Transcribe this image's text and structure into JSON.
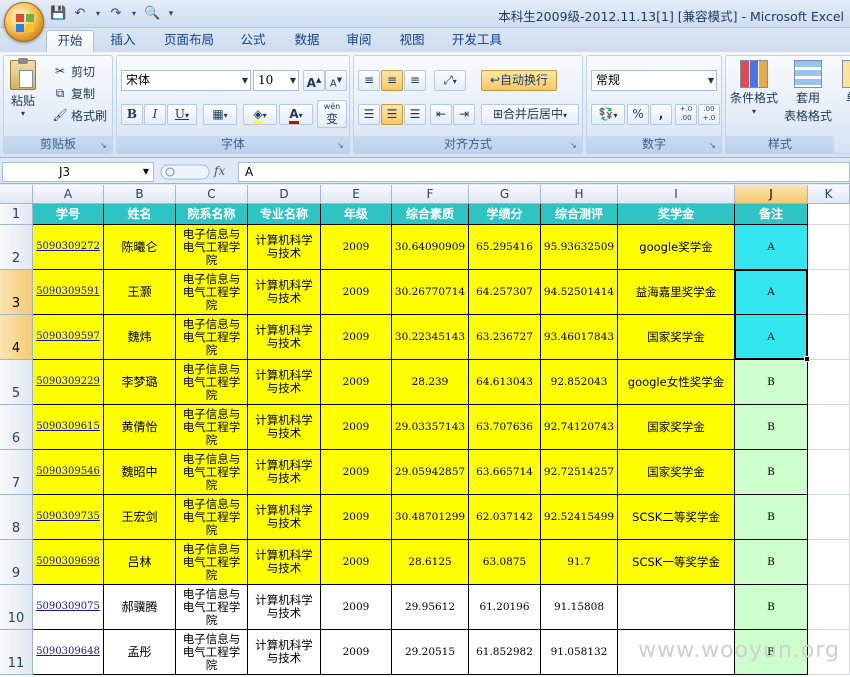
{
  "window": {
    "title": "本科生2009级-2012.11.13[1]  [兼容模式] - Microsoft Excel"
  },
  "tabs": [
    "开始",
    "插入",
    "页面布局",
    "公式",
    "数据",
    "审阅",
    "视图",
    "开发工具"
  ],
  "active_tab": "开始",
  "ribbon": {
    "clipboard": {
      "label": "剪贴板",
      "paste": "粘贴",
      "cut": "剪切",
      "copy": "复制",
      "format_painter": "格式刷"
    },
    "font": {
      "label": "字体",
      "font_name": "宋体",
      "font_size": "10",
      "grow": "A",
      "shrink": "A",
      "bold": "B",
      "italic": "I",
      "underline": "U",
      "font_color": "A",
      "phonetic": "wén",
      "phonetic_char": "变"
    },
    "alignment": {
      "label": "对齐方式",
      "wrap_text": "自动换行",
      "merge_center": "合并后居中"
    },
    "number": {
      "label": "数字",
      "format": "常规",
      "percent": "%",
      "comma": ",",
      "inc_decimal": "+.0\n.00",
      "dec_decimal": ".00\n+.0"
    },
    "styles": {
      "label": "样式",
      "conditional": "条件格式",
      "table_line1": "套用",
      "table_line2": "表格格式",
      "cell_styles": "单"
    }
  },
  "formula_bar": {
    "name_box": "J3",
    "fx": "fx",
    "content": "A"
  },
  "columns": [
    "A",
    "B",
    "C",
    "D",
    "E",
    "F",
    "G",
    "H",
    "I",
    "J",
    "K"
  ],
  "selected_column": "J",
  "selected_rows": [
    "3",
    "4"
  ],
  "header_row": {
    "row": "1",
    "cells": [
      "学号",
      "姓名",
      "院系名称",
      "专业名称",
      "年级",
      "综合素质",
      "学绩分",
      "综合测评",
      "奖学金",
      "备注"
    ]
  },
  "rows": [
    {
      "row": "2",
      "id": "5090309272",
      "name": "陈曦仑",
      "dept": "电子信息与电气工程学院",
      "major": "计算机科学与技术",
      "grade": "2009",
      "quality": "30.64090909",
      "gpa": "65.295416",
      "total": "95.93632509",
      "award": "google奖学金",
      "note": "A"
    },
    {
      "row": "3",
      "id": "5090309591",
      "name": "王灏",
      "dept": "电子信息与电气工程学院",
      "major": "计算机科学与技术",
      "grade": "2009",
      "quality": "30.26770714",
      "gpa": "64.257307",
      "total": "94.52501414",
      "award": "益海嘉里奖学金",
      "note": "A"
    },
    {
      "row": "4",
      "id": "5090309597",
      "name": "魏炜",
      "dept": "电子信息与电气工程学院",
      "major": "计算机科学与技术",
      "grade": "2009",
      "quality": "30.22345143",
      "gpa": "63.236727",
      "total": "93.46017843",
      "award": "国家奖学金",
      "note": "A"
    },
    {
      "row": "5",
      "id": "5090309229",
      "name": "李梦璐",
      "dept": "电子信息与电气工程学院",
      "major": "计算机科学与技术",
      "grade": "2009",
      "quality": "28.239",
      "gpa": "64.613043",
      "total": "92.852043",
      "award": "google女性奖学金",
      "note": "B"
    },
    {
      "row": "6",
      "id": "5090309615",
      "name": "黄倩怡",
      "dept": "电子信息与电气工程学院",
      "major": "计算机科学与技术",
      "grade": "2009",
      "quality": "29.03357143",
      "gpa": "63.707636",
      "total": "92.74120743",
      "award": "国家奖学金",
      "note": "B"
    },
    {
      "row": "7",
      "id": "5090309546",
      "name": "魏昭中",
      "dept": "电子信息与电气工程学院",
      "major": "计算机科学与技术",
      "grade": "2009",
      "quality": "29.05942857",
      "gpa": "63.665714",
      "total": "92.72514257",
      "award": "国家奖学金",
      "note": "B"
    },
    {
      "row": "8",
      "id": "5090309735",
      "name": "王宏剑",
      "dept": "电子信息与电气工程学院",
      "major": "计算机科学与技术",
      "grade": "2009",
      "quality": "30.48701299",
      "gpa": "62.037142",
      "total": "92.52415499",
      "award": "SCSK二等奖学金",
      "note": "B"
    },
    {
      "row": "9",
      "id": "5090309698",
      "name": "吕林",
      "dept": "电子信息与电气工程学院",
      "major": "计算机科学与技术",
      "grade": "2009",
      "quality": "28.6125",
      "gpa": "63.0875",
      "total": "91.7",
      "award": "SCSK一等奖学金",
      "note": "B"
    },
    {
      "row": "10",
      "id": "5090309075",
      "name": "郝骥腾",
      "dept": "电子信息与电气工程学院",
      "major": "计算机科学与技术",
      "grade": "2009",
      "quality": "29.95612",
      "gpa": "61.20196",
      "total": "91.15808",
      "award": "",
      "note": "B"
    },
    {
      "row": "11",
      "id": "5090309648",
      "name": "孟彤",
      "dept": "电子信息与电气工程学院",
      "major": "计算机科学与技术",
      "grade": "2009",
      "quality": "29.20515",
      "gpa": "61.852982",
      "total": "91.058132",
      "award": "",
      "note": "B"
    }
  ],
  "colors": {
    "header_fill": "#2ec4c4",
    "highlight_fill": "#ffff00",
    "note_a_fill": "#33e6f0",
    "note_b_fill": "#ccffcc",
    "plain_fill": "#ffffff",
    "link": "#1515a0"
  },
  "watermark": "www.wooyun.org"
}
